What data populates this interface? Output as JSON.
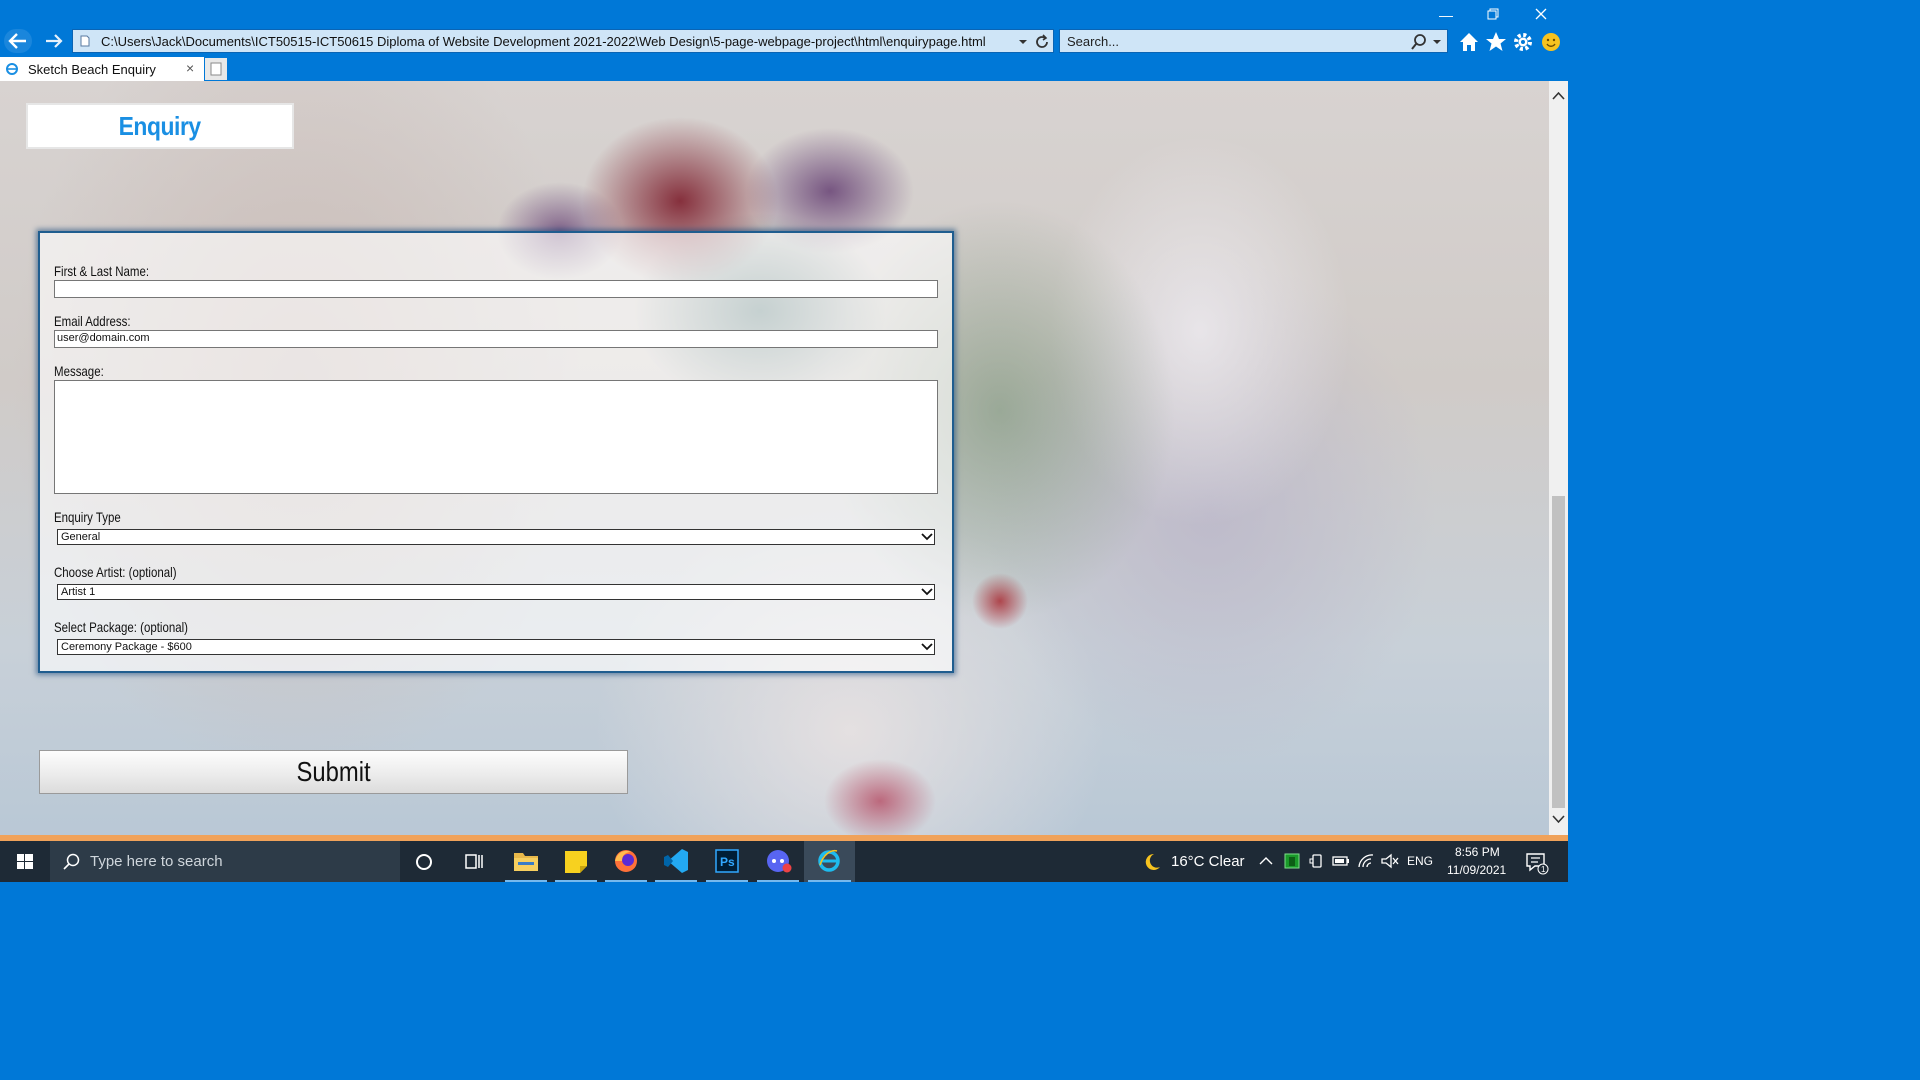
{
  "browser": {
    "address": "C:\\Users\\Jack\\Documents\\ICT50515-ICT50615 Diploma of Website Development 2021-2022\\Web Design\\5-page-webpage-project\\html\\enquirypage.html",
    "search_placeholder": "Search...",
    "tab_title": "Sketch Beach Enquiry",
    "tab_close": "×"
  },
  "page": {
    "heading": "Enquiry",
    "form": {
      "name_label": "First & Last Name:",
      "name_value": "",
      "email_label": "Email Address:",
      "email_value": "user@domain.com",
      "message_label": "Message:",
      "enquiry_type_label": "Enquiry Type",
      "enquiry_type_value": "General",
      "artist_label": "Choose Artist: (optional)",
      "artist_value": "Artist 1",
      "package_label": "Select Package: (optional)",
      "package_value": "Ceremony Package - $600"
    },
    "submit_label": "Submit"
  },
  "taskbar": {
    "search_placeholder": "Type here to search",
    "weather": "16°C  Clear",
    "language": "ENG",
    "time": "8:56 PM",
    "date": "11/09/2021",
    "notification_count": "1"
  },
  "colors": {
    "titlebar": "#0078d7",
    "heading": "#1a8fe3",
    "form_border": "#1f5d8f",
    "taskbar": "#1e2a36"
  }
}
